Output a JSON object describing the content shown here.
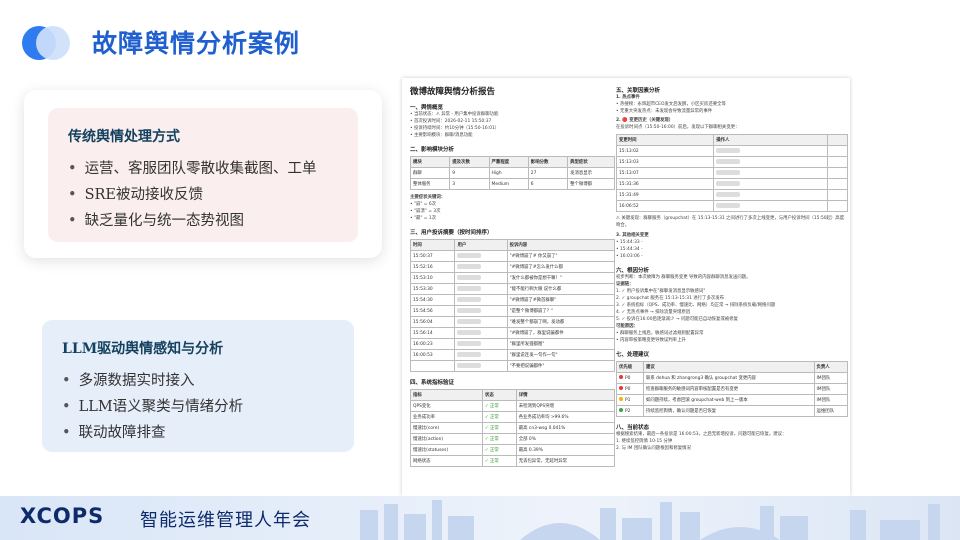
{
  "title": "故障舆情分析案例",
  "card1": {
    "heading": "传统舆情处理方式",
    "items": [
      "运营、客服团队零散收集截图、工单",
      "SRE被动接收反馈",
      "缺乏量化与统一态势视图"
    ]
  },
  "card2": {
    "heading": "LLM驱动舆情感知与分析",
    "items": [
      "多源数据实时接入",
      "LLM语义聚类与情绪分析",
      "联动故障排查"
    ]
  },
  "doc": {
    "title": "微博故障舆情分析报告",
    "s1": "一、舆情概览",
    "overview": [
      "当前状态：⚠ 异常 - 用户集中投诉群聊功能",
      "首次投诉时间：2026-02-11 15:50:37",
      "投诉持续时间：约10分钟（15:50-16:01）",
      "主要影响模块：群聊/消息功能"
    ],
    "s2": "二、影响模块分析",
    "modules_head": [
      "模块",
      "提及次数",
      "严重程度",
      "影响分数",
      "典型症状"
    ],
    "modules": [
      [
        "群聊",
        "9",
        "High",
        "27",
        "发消息显示"
      ],
      [
        "整体服务",
        "3",
        "Medium",
        "6",
        "整个微博都"
      ]
    ],
    "keywords_title": "主要症状关键词：",
    "keywords": [
      "\"崩\" = 6次",
      "\"崩溃\" = 3次",
      "\"最\" = 1次"
    ],
    "s3": "三、用户投诉摘要（按时间排序）",
    "complaints_head": [
      "时间",
      "用户",
      "投诉内容"
    ],
    "complaints": [
      [
        "15:50:37",
        "\"#微博崩了# 你又崩了\""
      ],
      [
        "15:52:16",
        "\"#微博崩了#怎么发什么都"
      ],
      [
        "15:53:10",
        "\"发什么都被你是想干嘛！\""
      ],
      [
        "15:53:30",
        "\"能不能行啊大眼 说什么都"
      ],
      [
        "15:54:30",
        "\"#微博崩了#微首群聊\""
      ],
      [
        "15:54:56",
        "\"是整个微博都崩了？\""
      ],
      [
        "15:56:04",
        "\"难发整个都崩了啊，发动都"
      ],
      [
        "15:56:14",
        "\"#微博崩了，群里说骗都件"
      ],
      [
        "16:00:23",
        "\"群里所发骚都图\""
      ],
      [
        "16:00:53",
        "\"群里说连发一句作一句\""
      ],
      [
        "",
        "\"不要把说骗都件\""
      ]
    ],
    "s4": "四、系统指标验证",
    "metrics_head": [
      "指标",
      "状态",
      "详情"
    ],
    "metrics": [
      [
        "QPS变化",
        "✓ 正常",
        "未检测到QPS突增"
      ],
      [
        "业务成功率",
        "✓ 正常",
        "各业务成功率均 >99.6%"
      ],
      [
        "慢速比(core)",
        "✓ 正常",
        "最高 cn3-wsg 0.041%"
      ],
      [
        "慢速比(action)",
        "✓ 正常",
        "全部 0%"
      ],
      [
        "慢速比(statuses)",
        "✓ 正常",
        "最高 0.39%"
      ],
      [
        "网络状态",
        "✓ 正常",
        "无丢包异常，无延时异常"
      ]
    ],
    "s5": "五、关联因素分析",
    "hot_title": "1. 热点事件",
    "hot": [
      "热搜榜：永辉超市CEO发文后发酵，小区买房还要全等",
      "无重大突发热点：未发现会导致流量异常的事件"
    ],
    "change_title": "2. 🔴 变更历史（关键发现）",
    "change_note": "在投诉时间点（15:50-16:00）前后，发现以下群聊相关变更：",
    "change_head": [
      "变更时间",
      "操作人",
      ""
    ],
    "changes": [
      "15:13:02",
      "15:13:03",
      "15:13:07",
      "15:31:36",
      "15:31:49",
      "16:06:52"
    ],
    "key_find": "⚠ 关键发现：群聊服务（groupchat）在 15:13-15:31 之间进行了多次上线变更，与用户投诉时间（15:50起）高度吻合。",
    "other_title": "3. 其他相关变更",
    "other": [
      "15:44:33 -",
      "15:44:34 -",
      "16:03:06 -"
    ],
    "s6": "六、根因分析",
    "root": "初步判断：本次故障为 群聊服务变更 导致的内容群聊消息发送问题。",
    "chain_title": "证据链：",
    "chain": [
      "1. ✓ 用户投诉集中在\"群聊发消息显示敏感词\"",
      "2. ✓ groupchat 服务在 15:13-15:31 进行了多次发布",
      "3. ✓ 系统指标（QPS、成功率、慢速比、网络）均正常 → 排除系统负载/网络问题",
      "4. ✓ 无热点事件 → 排除流量突增原因",
      "5. ✓ 投诉在16:00后逐渐减少 → 问题可能已自动恢复或被修复"
    ],
    "possible_title": "可能原因：",
    "possible": [
      "群聊服务上线后，敏感词过滤规则配置异常",
      "内容审核策略变更导致误判率上升"
    ],
    "s7": "七、处理建议",
    "suggest_head": [
      "优先级",
      "建议",
      "负责人"
    ],
    "suggest": [
      [
        "P0",
        "#e53935",
        "联系 dehua 和 zhangrong3 确认 groupchat 变更内容",
        "IM团队"
      ],
      [
        "P0",
        "#e53935",
        "检查群聊服务的敏感词内容审核配置是否有变更",
        "IM团队"
      ],
      [
        "P1",
        "#f4b400",
        "如问题持续，考虑回滚 groupchat-web 到上一版本",
        "IM团队"
      ],
      [
        "P2",
        "#43a047",
        "持续监控舆情，确认问题是否已恢复",
        "运维团队"
      ]
    ],
    "s8": "八、当前状态",
    "status": [
      "根据搜索结果，最后一条投诉是 16:00:53，之后无新增投诉，问题可能已恢复。建议：",
      "1. 继续监控舆情 10-15 分钟",
      "2. 与 IM 团队确认问题根因和修复情况"
    ]
  },
  "footer": {
    "brand": "XCOPS",
    "sub": "智能运维管理人年会"
  }
}
